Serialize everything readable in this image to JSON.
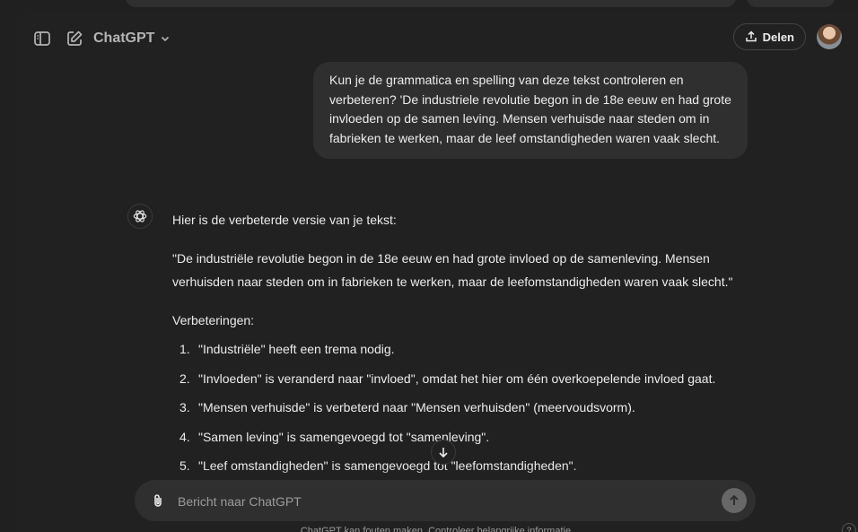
{
  "header": {
    "model_label": "ChatGPT",
    "share_label": "Delen",
    "icons": {
      "sidebar": "sidebar-toggle-icon",
      "new_chat": "new-chat-icon",
      "model_chevron": "chevron-down-icon",
      "share": "share-icon"
    }
  },
  "conversation": {
    "user_message": "Kun je de grammatica en spelling van deze tekst controleren en verbeteren? 'De industriele revolutie begon in de 18e eeuw en had grote invloeden op de samen leving. Mensen verhuisde naar steden om in fabrieken te werken, maar de leef omstandigheden waren vaak slecht.",
    "assistant": {
      "intro": "Hier is de verbeterde versie van je tekst:",
      "corrected": "\"De industriële revolutie begon in de 18e eeuw en had grote invloed op de samenleving. Mensen verhuisden naar steden om in fabrieken te werken, maar de leefomstandigheden waren vaak slecht.\"",
      "improvements_heading": "Verbeteringen:",
      "improvements": [
        {
          "num": "1.",
          "text": "\"Industriële\" heeft een trema nodig."
        },
        {
          "num": "2.",
          "text": "\"Invloeden\" is veranderd naar \"invloed\", omdat het hier om één overkoepelende invloed gaat."
        },
        {
          "num": "3.",
          "text": "\"Mensen verhuisde\" is verbeterd naar \"Mensen verhuisden\" (meervoudsvorm)."
        },
        {
          "num": "4.",
          "text": "\"Samen leving\" is samengevoegd tot \"samenleving\"."
        },
        {
          "num": "5.",
          "text": "\"Leef omstandigheden\" is samengevoegd tot \"leefomstandigheden\"."
        }
      ]
    }
  },
  "composer": {
    "placeholder": "Bericht naar ChatGPT",
    "value": ""
  },
  "disclaimer": "ChatGPT kan fouten maken. Controleer belangrijke informatie.",
  "help_label": "?",
  "colors": {
    "background": "#212121",
    "bubble": "#2f2f2f",
    "text": "#ececec",
    "muted": "#9b9b9b"
  }
}
